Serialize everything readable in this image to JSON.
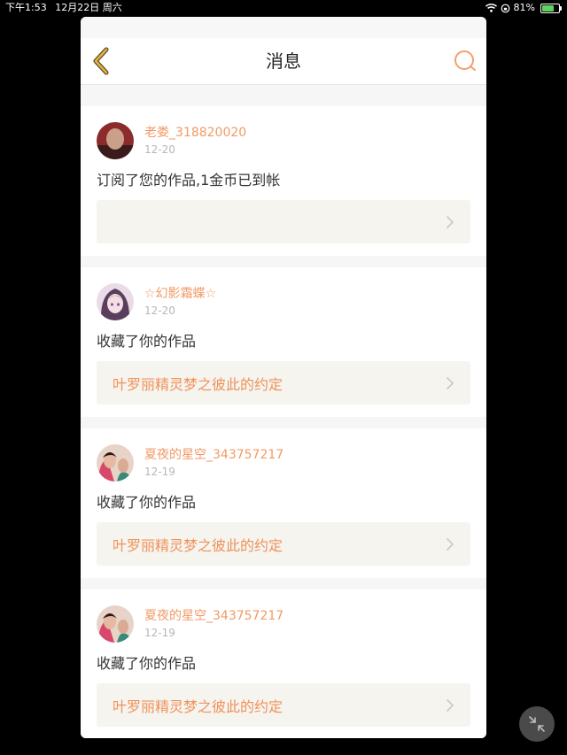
{
  "status_bar": {
    "time": "下午1:53",
    "date": "12月22日 周六",
    "battery": "81%",
    "battery_level": 0.81
  },
  "header": {
    "title": "消息"
  },
  "messages": [
    {
      "username": "老娄_318820020",
      "date": "12-20",
      "text": "订阅了您的作品,1金币已到帐",
      "work": ""
    },
    {
      "username": "☆幻影霜蝶☆",
      "date": "12-20",
      "text": "收藏了你的作品",
      "work": "叶罗丽精灵梦之彼此的约定"
    },
    {
      "username": "夏夜的星空_343757217",
      "date": "12-19",
      "text": "收藏了你的作品",
      "work": "叶罗丽精灵梦之彼此的约定"
    },
    {
      "username": "夏夜的星空_343757217",
      "date": "12-19",
      "text": "收藏了你的作品",
      "work": "叶罗丽精灵梦之彼此的约定"
    }
  ],
  "colors": {
    "accent": "#f19a65",
    "link": "#f0925a",
    "link_bg": "#f5f4ef",
    "back_icon": "#d9a93a"
  }
}
